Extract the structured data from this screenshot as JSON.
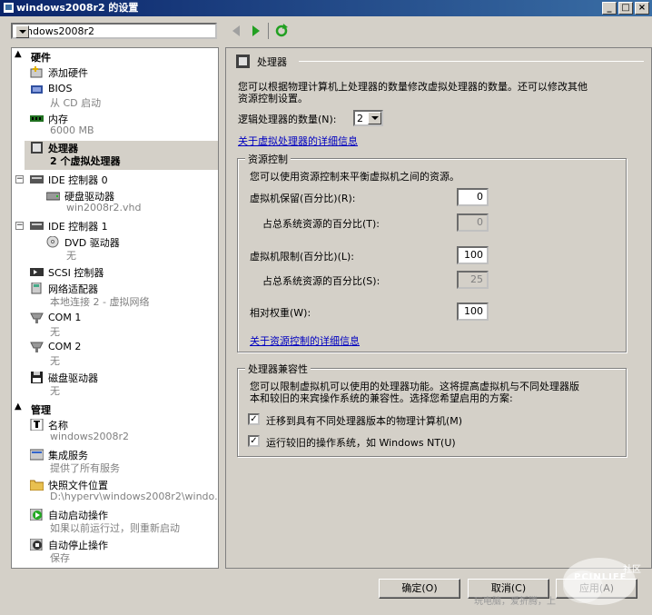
{
  "window": {
    "title": "windows2008r2 的设置",
    "minimize": "_",
    "maximize": "□",
    "close": "×"
  },
  "vm_selector": {
    "value": "windows2008r2"
  },
  "tree": {
    "hardware_header": "硬件",
    "items": [
      {
        "label": "添加硬件",
        "sub": ""
      },
      {
        "label": "BIOS",
        "sub": "从 CD 启动"
      },
      {
        "label": "内存",
        "sub": "6000 MB"
      },
      {
        "label": "处理器",
        "sub": "2 个虚拟处理器"
      },
      {
        "label": "IDE 控制器 0",
        "sub": ""
      },
      {
        "label": "硬盘驱动器",
        "sub": "win2008r2.vhd"
      },
      {
        "label": "IDE 控制器 1",
        "sub": ""
      },
      {
        "label": "DVD 驱动器",
        "sub": "无"
      },
      {
        "label": "SCSI 控制器",
        "sub": ""
      },
      {
        "label": "网络适配器",
        "sub": "本地连接 2 - 虚拟网络"
      },
      {
        "label": "COM 1",
        "sub": "无"
      },
      {
        "label": "COM 2",
        "sub": "无"
      },
      {
        "label": "磁盘驱动器",
        "sub": "无"
      }
    ],
    "management_header": "管理",
    "mgmt_items": [
      {
        "label": "名称",
        "sub": "windows2008r2"
      },
      {
        "label": "集成服务",
        "sub": "提供了所有服务"
      },
      {
        "label": "快照文件位置",
        "sub": "D:\\hyperv\\windows2008r2\\windo..."
      },
      {
        "label": "自动启动操作",
        "sub": "如果以前运行过，则重新启动"
      },
      {
        "label": "自动停止操作",
        "sub": "保存"
      }
    ]
  },
  "processor": {
    "title": "处理器",
    "description": [
      "您可以根据物理计算机上处理器的数量修改虚拟处理器的数量。还可以修改其他",
      "资源控制设置。"
    ],
    "count_label": "逻辑处理器的数量(N):",
    "count_value": "2",
    "details_link": "关于虚拟处理器的详细信息",
    "resource": {
      "title": "资源控制",
      "desc": "您可以使用资源控制来平衡虚拟机之间的资源。",
      "reserve_label": "虚拟机保留(百分比)(R):",
      "reserve_value": "0",
      "reserve_pct_label": "占总系统资源的百分比(T):",
      "reserve_pct_value": "0",
      "limit_label": "虚拟机限制(百分比)(L):",
      "limit_value": "100",
      "limit_pct_label": "占总系统资源的百分比(S):",
      "limit_pct_value": "25",
      "weight_label": "相对权重(W):",
      "weight_value": "100",
      "link": "关于资源控制的详细信息"
    },
    "compat": {
      "title": "处理器兼容性",
      "desc": [
        "您可以限制虚拟机可以使用的处理器功能。这将提高虚拟机与不同处理器版",
        "本和较旧的来宾操作系统的兼容性。选择您希望启用的方案:"
      ],
      "opt1": "迁移到具有不同处理器版本的物理计算机(M)",
      "opt1_checked": true,
      "opt2": "运行较旧的操作系统，如 Windows NT(U)",
      "opt2_checked": true
    }
  },
  "buttons": {
    "ok": "确定(O)",
    "cancel": "取消(C)",
    "apply": "应用(A)"
  },
  "watermark": {
    "brand": "PCINLIFE",
    "tag": "社区",
    "slogan": "玩电脑，爱折腾，上"
  },
  "colors": {
    "titlebar": "#0a246a",
    "link": "#0000c0",
    "selection": "#d4d0c8"
  }
}
